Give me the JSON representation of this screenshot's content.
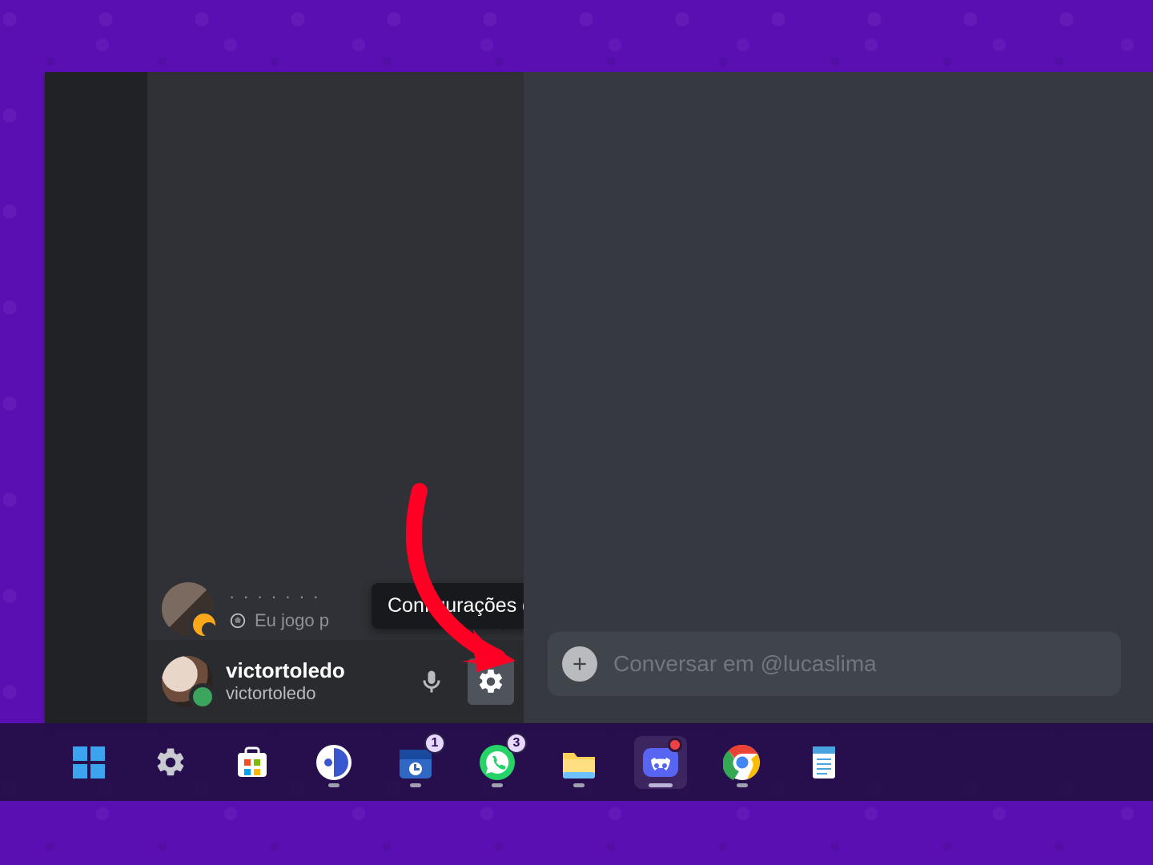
{
  "dm": {
    "status_text": "Eu jogo p"
  },
  "tooltip": {
    "text": "Configurações de Usuário"
  },
  "user_panel": {
    "display_name": "victortoledo",
    "username": "victortoledo"
  },
  "message_input": {
    "placeholder": "Conversar em @lucaslima"
  },
  "taskbar": {
    "calendar_badge": "1",
    "whatsapp_badge": "3"
  }
}
